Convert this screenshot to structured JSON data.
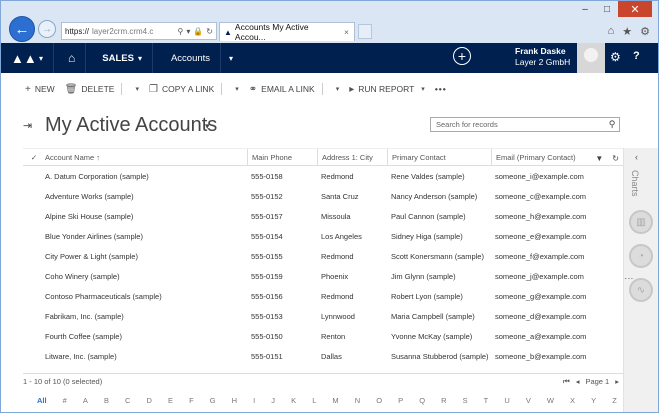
{
  "browser": {
    "url_prefix": "https://",
    "url_host": "layer2crm.crm4.c",
    "tab_title": "Accounts My Active Accou...",
    "tab_close": "×",
    "min": "–",
    "max": "□",
    "close": "✕"
  },
  "nav": {
    "area": "SALES",
    "entity": "Accounts",
    "user_name": "Frank Daske",
    "user_org": "Layer 2 GmbH"
  },
  "commands": {
    "new": "NEW",
    "delete": "DELETE",
    "copy_link": "COPY A LINK",
    "email_link": "EMAIL A LINK",
    "run_report": "RUN REPORT",
    "more": "•••"
  },
  "view": {
    "title": "My Active Accounts",
    "search_placeholder": "Search for records"
  },
  "grid": {
    "headers": [
      "Account Name ↑",
      "Main Phone",
      "Address 1: City",
      "Primary Contact",
      "Email (Primary Contact)"
    ],
    "rows": [
      [
        "A. Datum Corporation (sample)",
        "555-0158",
        "Redmond",
        "Rene Valdes (sample)",
        "someone_i@example.com"
      ],
      [
        "Adventure Works (sample)",
        "555-0152",
        "Santa Cruz",
        "Nancy Anderson (sample)",
        "someone_c@example.com"
      ],
      [
        "Alpine Ski House (sample)",
        "555-0157",
        "Missoula",
        "Paul Cannon (sample)",
        "someone_h@example.com"
      ],
      [
        "Blue Yonder Airlines (sample)",
        "555-0154",
        "Los Angeles",
        "Sidney Higa (sample)",
        "someone_e@example.com"
      ],
      [
        "City Power & Light (sample)",
        "555-0155",
        "Redmond",
        "Scott Konersmann (sample)",
        "someone_f@example.com"
      ],
      [
        "Coho Winery (sample)",
        "555-0159",
        "Phoenix",
        "Jim Glynn (sample)",
        "someone_j@example.com"
      ],
      [
        "Contoso Pharmaceuticals (sample)",
        "555-0156",
        "Redmond",
        "Robert Lyon (sample)",
        "someone_g@example.com"
      ],
      [
        "Fabrikam, Inc. (sample)",
        "555-0153",
        "Lynnwood",
        "Maria Campbell (sample)",
        "someone_d@example.com"
      ],
      [
        "Fourth Coffee (sample)",
        "555-0150",
        "Renton",
        "Yvonne McKay (sample)",
        "someone_a@example.com"
      ],
      [
        "Litware, Inc. (sample)",
        "555-0151",
        "Dallas",
        "Susanna Stubberod (sample)",
        "someone_b@example.com"
      ]
    ]
  },
  "right_pane": {
    "label": "Charts"
  },
  "footer": {
    "count": "1 - 10 of 10 (0 selected)",
    "page": "Page 1"
  },
  "alphabet": [
    "All",
    "#",
    "A",
    "B",
    "C",
    "D",
    "E",
    "F",
    "G",
    "H",
    "I",
    "J",
    "K",
    "L",
    "M",
    "N",
    "O",
    "P",
    "Q",
    "R",
    "S",
    "T",
    "U",
    "V",
    "W",
    "X",
    "Y",
    "Z"
  ]
}
